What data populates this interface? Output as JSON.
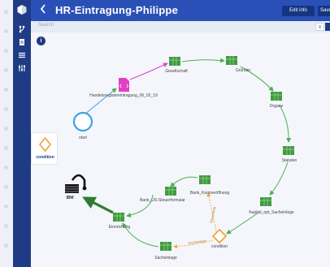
{
  "header": {
    "title": "HR-Eintragung-Philippe",
    "back_icon": "chevron-left-icon",
    "edit_label": "Edit info",
    "save_label": "Save"
  },
  "search": {
    "placeholder": "Search"
  },
  "sidebar": {
    "items": [
      {
        "icon": "logo-hexagon-icon"
      },
      {
        "icon": "branch-icon"
      },
      {
        "icon": "document-icon"
      },
      {
        "icon": "list-icon"
      },
      {
        "icon": "sliders-icon"
      }
    ]
  },
  "palette": {
    "label": "condition"
  },
  "info_icon": "info-icon",
  "diagram": {
    "nodes": {
      "start": "start",
      "handelsregister": "Handelsregistereintragung_06_02_19",
      "gesellschaft": "Gesellschaft",
      "gruender": "Gründer",
      "organe": "Organe",
      "statuten": "Statuten",
      "kapital": "Kapital_opt_Sacheinlage",
      "condition": "condition",
      "bank_konto": "Bank_Kontoeröffnung",
      "bank_steuer": "Bank_US-Steuerformular",
      "einreichung": "Einreichung",
      "sacheinlage": "Sacheinlage",
      "ibm": "IBM"
    },
    "edges": {
      "bar_label": "Barzahlung",
      "sach_label": "Sacheinlage"
    }
  },
  "colors": {
    "sidebar": "#1f3b86",
    "topbar": "#2a50b8",
    "flow_green": "#4caf50",
    "task_green": "#3f9b3f",
    "condition_orange": "#f0a030",
    "start_blue": "#3ea0e8",
    "pink": "#e040c8"
  }
}
